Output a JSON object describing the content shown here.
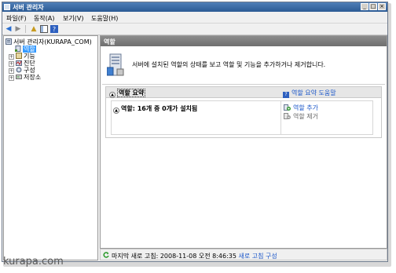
{
  "window": {
    "title": "서버 관리자"
  },
  "menu": [
    {
      "label": "파일(F)"
    },
    {
      "label": "동작(A)"
    },
    {
      "label": "보기(V)"
    },
    {
      "label": "도움말(H)"
    }
  ],
  "tree": {
    "root": "서버 관리자(KURAPA_COM)",
    "items": [
      {
        "label": "역할",
        "selected": true
      },
      {
        "label": "기능"
      },
      {
        "label": "진단"
      },
      {
        "label": "구성"
      },
      {
        "label": "저장소"
      }
    ]
  },
  "main": {
    "header": "역할",
    "description": "서버에 설치된 역할의 상태를 보고 역할 및 기능을 추가하거나 제거합니다.",
    "summary": {
      "title": "역할 요약",
      "help_link": "역할 요약 도움말",
      "roles_status": "역할: 16개 중 0개가 설치됨",
      "actions": [
        {
          "label": "역할 추가",
          "enabled": true
        },
        {
          "label": "역할 제거",
          "enabled": false
        }
      ]
    }
  },
  "status": {
    "text": "마지막 새로 고침: 2008-11-08 오전 8:46:35",
    "link": "새로 고침 구성"
  },
  "watermark": "kurapa.com"
}
